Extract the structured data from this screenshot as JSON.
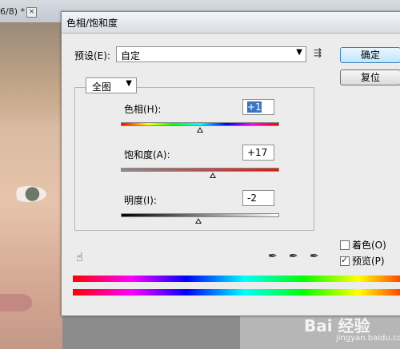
{
  "document_tab": {
    "label": "6/8) *",
    "close_label": "×"
  },
  "dialog": {
    "title": "色相/饱和度",
    "preset": {
      "label": "预设(E):",
      "value": "自定"
    },
    "buttons": {
      "ok": "确定",
      "reset": "复位"
    },
    "channel": {
      "value": "全图"
    },
    "controls": {
      "hue": {
        "label": "色相(H):",
        "value": "+1",
        "slider_fraction": 0.5
      },
      "saturation": {
        "label": "饱和度(A):",
        "value": "+17",
        "slider_fraction": 0.58
      },
      "lightness": {
        "label": "明度(I):",
        "value": "-2",
        "slider_fraction": 0.49
      }
    },
    "colorize": {
      "label": "着色(O)",
      "checked": false
    },
    "preview": {
      "label": "预览(P)",
      "checked": true
    }
  },
  "watermark": {
    "text": "Bai 经验",
    "sub": "jingyan.baidu.com"
  }
}
